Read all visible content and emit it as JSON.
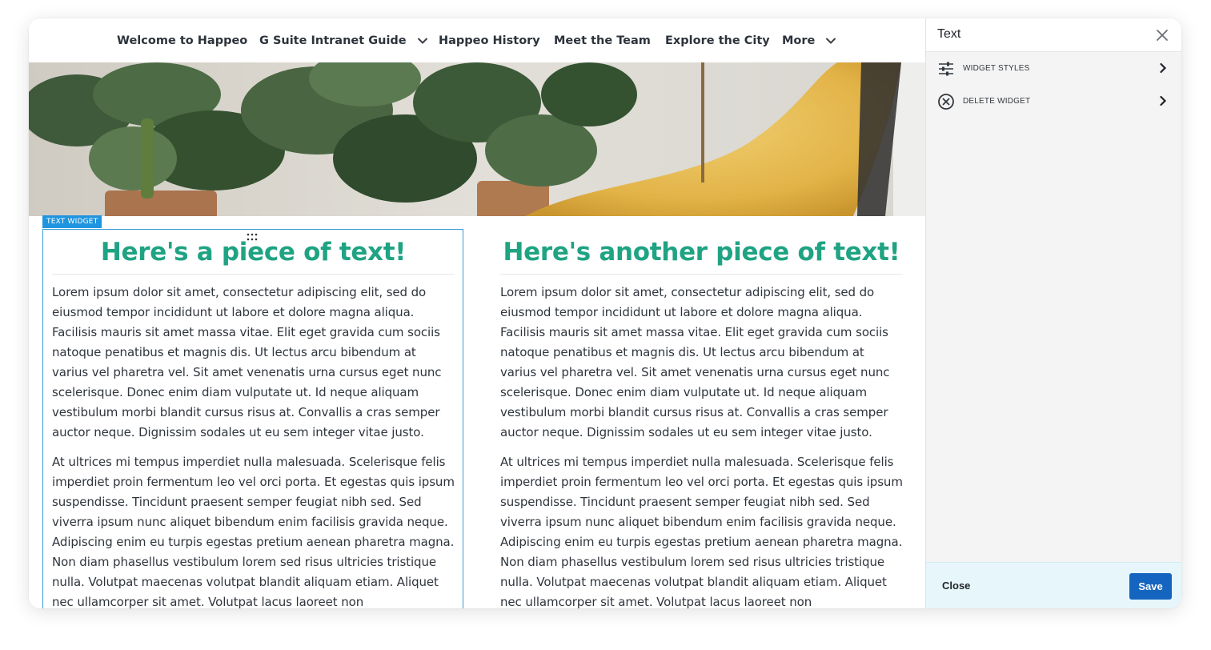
{
  "nav": {
    "items": [
      {
        "label": "Welcome to Happeo",
        "has_dropdown": false
      },
      {
        "label": "G Suite Intranet Guide",
        "has_dropdown": true
      },
      {
        "label": "Happeo History",
        "has_dropdown": false
      },
      {
        "label": "Meet the Team",
        "has_dropdown": false
      },
      {
        "label": "Explore the City",
        "has_dropdown": false
      },
      {
        "label": "More",
        "has_dropdown": true
      }
    ]
  },
  "widget": {
    "tag_label": "TEXT WIDGET"
  },
  "columns": [
    {
      "heading": "Here's a piece of text!",
      "paragraphs": [
        "Lorem ipsum dolor sit amet, consectetur adipiscing elit, sed do eiusmod tempor incididunt ut labore et dolore magna aliqua. Facilisis mauris sit amet massa vitae. Elit eget gravida cum sociis natoque penatibus et magnis dis. Ut lectus arcu bibendum at varius vel pharetra vel. Sit amet venenatis urna cursus eget nunc scelerisque. Donec enim diam vulputate ut. Id neque aliquam vestibulum morbi blandit cursus risus at. Convallis a cras semper auctor neque. Dignissim sodales ut eu sem integer vitae justo.",
        "At ultrices mi tempus imperdiet nulla malesuada. Scelerisque felis imperdiet proin fermentum leo vel orci porta. Et egestas quis ipsum suspendisse. Tincidunt praesent semper feugiat nibh sed. Sed viverra ipsum nunc aliquet bibendum enim facilisis gravida neque. Adipiscing enim eu turpis egestas pretium aenean pharetra magna. Non diam phasellus vestibulum lorem sed risus ultricies tristique nulla. Volutpat maecenas volutpat blandit aliquam etiam. Aliquet nec ullamcorper sit amet. Volutpat lacus laoreet non"
      ]
    },
    {
      "heading": "Here's another piece of text!",
      "paragraphs": [
        "Lorem ipsum dolor sit amet, consectetur adipiscing elit, sed do eiusmod tempor incididunt ut labore et dolore magna aliqua. Facilisis mauris sit amet massa vitae. Elit eget gravida cum sociis natoque penatibus et magnis dis. Ut lectus arcu bibendum at varius vel pharetra vel. Sit amet venenatis urna cursus eget nunc scelerisque. Donec enim diam vulputate ut. Id neque aliquam vestibulum morbi blandit cursus risus at. Convallis a cras semper auctor neque. Dignissim sodales ut eu sem integer vitae justo.",
        "At ultrices mi tempus imperdiet nulla malesuada. Scelerisque felis imperdiet proin fermentum leo vel orci porta. Et egestas quis ipsum suspendisse. Tincidunt praesent semper feugiat nibh sed. Sed viverra ipsum nunc aliquet bibendum enim facilisis gravida neque. Adipiscing enim eu turpis egestas pretium aenean pharetra magna. Non diam phasellus vestibulum lorem sed risus ultricies tristique nulla. Volutpat maecenas volutpat blandit aliquam etiam. Aliquet nec ullamcorper sit amet. Volutpat lacus laoreet non"
      ]
    }
  ],
  "panel": {
    "title": "Text",
    "rows": [
      {
        "label": "WIDGET STYLES",
        "icon": "sliders-icon"
      },
      {
        "label": "DELETE WIDGET",
        "icon": "circle-x-icon"
      }
    ],
    "close_label": "Close",
    "save_label": "Save"
  },
  "colors": {
    "heading": "#1fa383",
    "accent": "#1f95e0",
    "save_button": "#1565c0",
    "footer_bg": "#e6f6fb"
  }
}
